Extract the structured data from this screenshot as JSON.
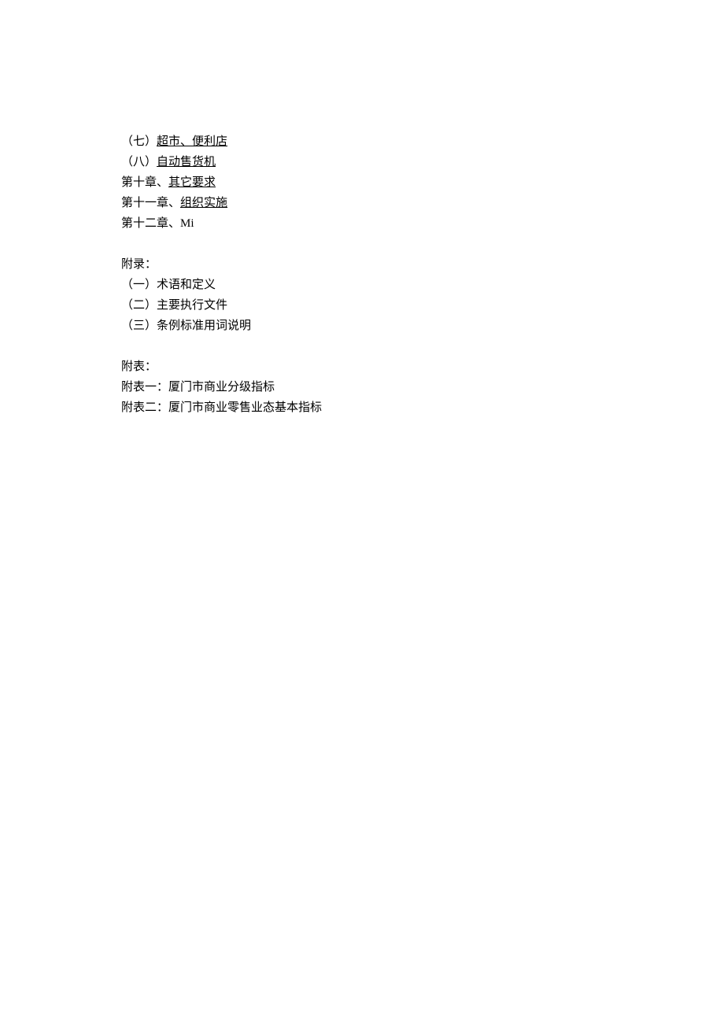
{
  "toc": {
    "item7_prefix": "（七）",
    "item7_link": "超市、便利店",
    "item8_prefix": "（八）",
    "item8_link": "自动售货机",
    "ch10_prefix": "第十章、",
    "ch10_link": "其它要求",
    "ch11_prefix": "第十一章、",
    "ch11_link": "组织实施",
    "ch12": "第十二章、Mi"
  },
  "appendix": {
    "title": "附录：",
    "item1": "（一）术语和定义",
    "item2": "（二）主要执行文件",
    "item3": "（三）条例标准用词说明"
  },
  "tables": {
    "title": "附表：",
    "item1": "附表一：厦门市商业分级指标",
    "item2": "附表二：厦门市商业零售业态基本指标"
  }
}
